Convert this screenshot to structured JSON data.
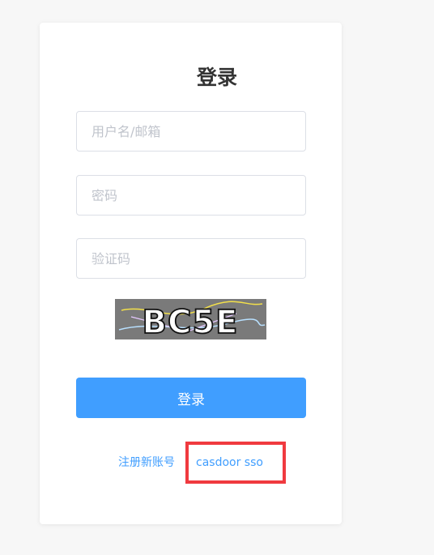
{
  "login": {
    "title": "登录",
    "username_placeholder": "用户名/邮箱",
    "password_placeholder": "密码",
    "captcha_placeholder": "验证码",
    "captcha_text": "BC5E",
    "submit_label": "登录",
    "register_link": "注册新账号",
    "sso_link": "casdoor sso"
  },
  "colors": {
    "primary": "#409eff",
    "highlight": "#f03a3f",
    "captcha_bg": "#7a7a7a"
  }
}
